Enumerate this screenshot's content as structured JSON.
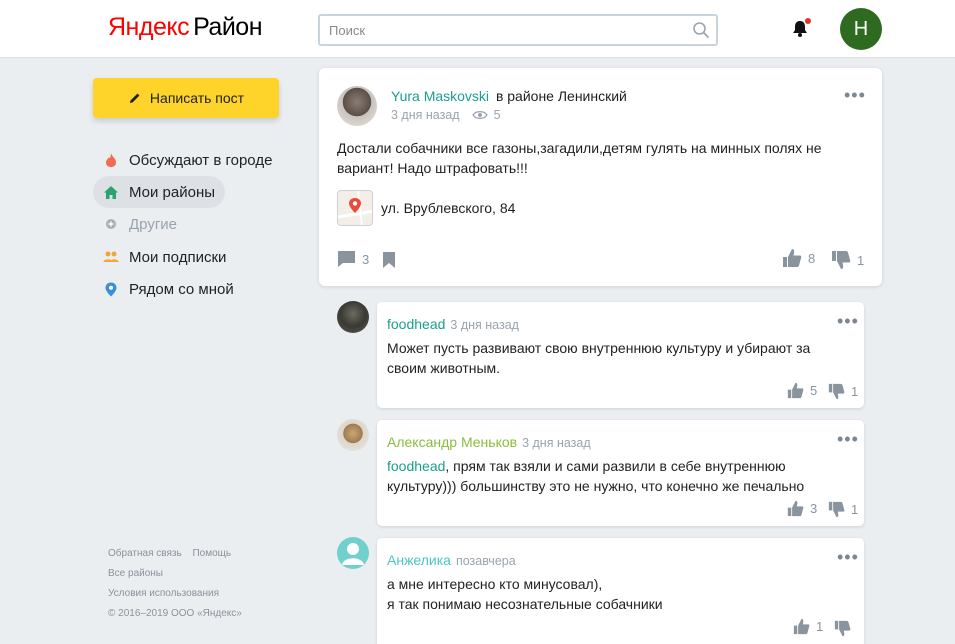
{
  "header": {
    "logo_yandex": "Яндекс",
    "logo_rayon": "Район",
    "search_placeholder": "Поиск",
    "avatar_letter": "Н"
  },
  "sidebar": {
    "write_button": "Написать пост",
    "items": [
      {
        "label": "Обсуждают в городе",
        "icon": "fire-icon"
      },
      {
        "label": "Мои районы",
        "icon": "home-icon"
      },
      {
        "label": "Другие",
        "icon": "plus-circle-icon"
      },
      {
        "label": "Мои подписки",
        "icon": "people-icon"
      },
      {
        "label": "Рядом со мной",
        "icon": "location-pin-icon"
      }
    ],
    "footer": {
      "feedback": "Обратная связь",
      "help": "Помощь",
      "all_districts": "Все районы",
      "terms": "Условия использования",
      "copyright": "© 2016–2019 ООО «Яндекс»"
    }
  },
  "post": {
    "author": "Yura Maskovski",
    "location": "в районе Ленинский",
    "time": "3 дня назад",
    "views": "5",
    "text": "Достали собачники все газоны,загадили,детям гулять на минных полях не вариант! Надо штрафовать!!!",
    "address": "ул. Врублевского, 84",
    "comments_count": "3",
    "likes": "8",
    "dislikes": "1"
  },
  "comments": [
    {
      "author": "foodhead",
      "time": "3 дня назад",
      "text": "Может пусть развивают свою внутреннюю культуру и убирают за своим животным.",
      "likes": "5",
      "dislikes": "1",
      "name_color": "#1aa08b"
    },
    {
      "author": "Александр Меньков",
      "time": "3 дня назад",
      "mention": "foodhead",
      "text": ", прям так взяли и сами развили в себе внутреннюю культуру))) большинству это не нужно, что конечно же печально",
      "likes": "3",
      "dislikes": "1",
      "name_color": "#8bbd3c"
    },
    {
      "author": "Анжелика",
      "time": "позавчера",
      "text_line1": "а мне интересно кто минусовал),",
      "text_line2": "я так понимаю несознательные собачники",
      "likes": "1",
      "dislikes": "",
      "name_color": "#4ec5c1"
    }
  ],
  "colors": {
    "accent_yellow": "#fed42b",
    "link_green": "#1aa08b",
    "avatar_green": "#2e6b20"
  }
}
